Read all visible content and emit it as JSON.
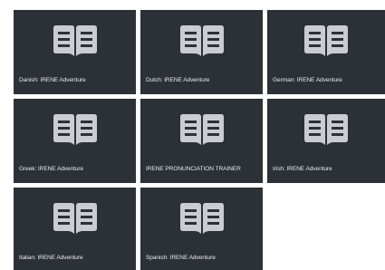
{
  "courses": [
    {
      "label": "Danish: IRENE Adventure",
      "icon": "open-book-icon"
    },
    {
      "label": "Dutch: IRENE Adventure",
      "icon": "open-book-icon"
    },
    {
      "label": "German: IRENE Adventure",
      "icon": "open-book-icon"
    },
    {
      "label": "Greek: IRENE Adventure",
      "icon": "open-book-icon"
    },
    {
      "label": "IRENE PRONUNCIATION TRAINER",
      "icon": "open-book-icon"
    },
    {
      "label": "Irish: IRENE Adventure",
      "icon": "open-book-icon"
    },
    {
      "label": "Italian: IRENE Adventure",
      "icon": "open-book-icon"
    },
    {
      "label": "Spanish: IRENE Adventure",
      "icon": "open-book-icon"
    }
  ],
  "colors": {
    "tile_background": "#2b3136",
    "icon": "#c9cdd1",
    "label_text": "#e8eaec",
    "page_background": "#ffffff"
  }
}
